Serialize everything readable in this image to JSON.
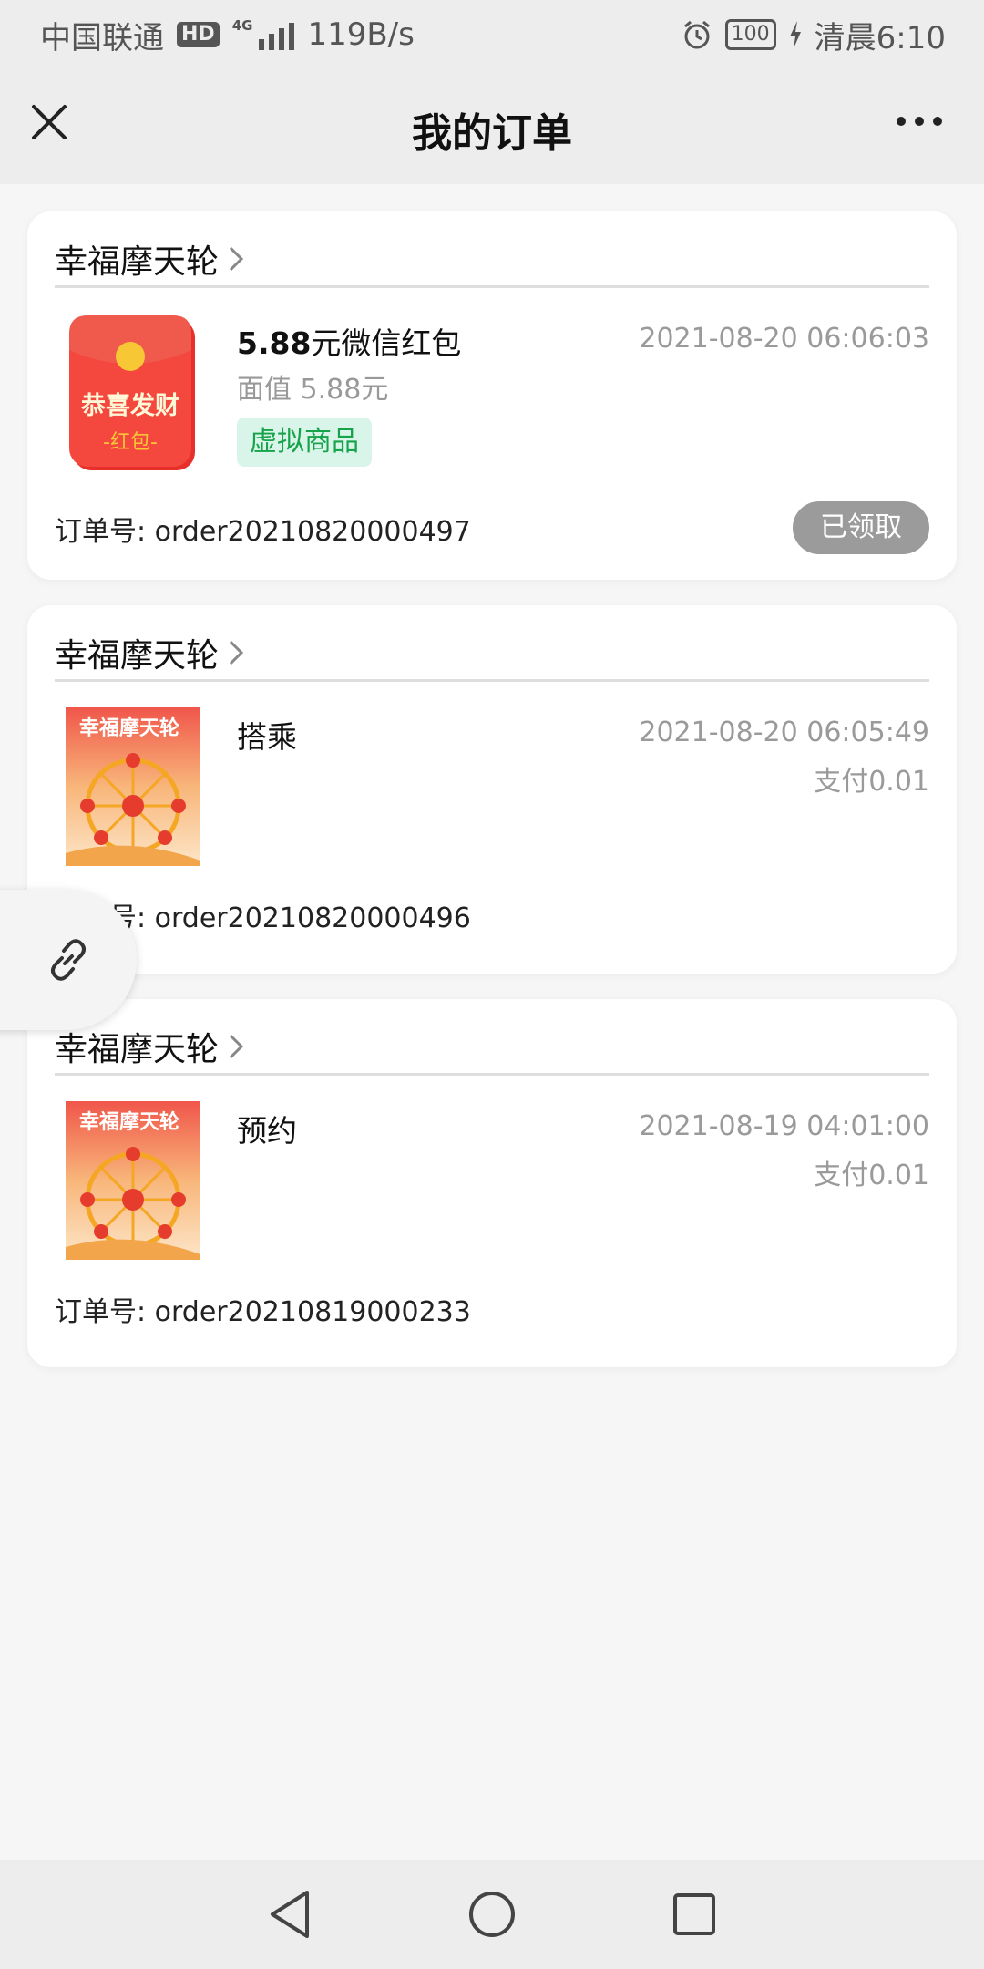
{
  "status_bar": {
    "carrier": "中国联通",
    "hd": "HD",
    "network": "4G",
    "speed": "119B/s",
    "battery": "100",
    "time": "清晨6:10"
  },
  "header": {
    "title": "我的订单"
  },
  "orders": [
    {
      "shop": "幸福摩天轮",
      "title_bold": "5.88",
      "title_rest": "元微信红包",
      "face_value": "面值  5.88元",
      "tag": "虚拟商品",
      "time": "2021-08-20 06:06:03",
      "order_no": "订单号: order20210820000497",
      "status_button": "已领取",
      "thumb_text_main": "恭喜发财",
      "thumb_text_sub": "-红包-"
    },
    {
      "shop": "幸福摩天轮",
      "title": "搭乘",
      "time": "2021-08-20 06:05:49",
      "pay": "支付0.01",
      "order_no": "订单号: order20210820000496",
      "thumb_text": "幸福摩天轮"
    },
    {
      "shop": "幸福摩天轮",
      "title": "预约",
      "time": "2021-08-19 04:01:00",
      "pay": "支付0.01",
      "order_no": "订单号: order20210819000233",
      "thumb_text": "幸福摩天轮"
    }
  ],
  "colors": {
    "accent_tag_bg": "#d9f5ea",
    "accent_tag_text": "#17a34a",
    "received_button": "#9b9b9b",
    "red_packet": "#f2403a"
  }
}
